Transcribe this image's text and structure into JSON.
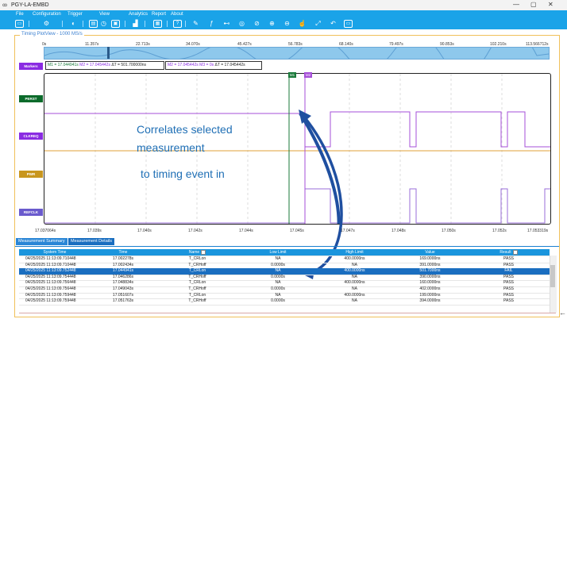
{
  "window": {
    "title": "PGY-LA-EMBD",
    "min": "—",
    "max": "▢",
    "close": "✕"
  },
  "menu": [
    "File",
    "Configuration",
    "Trigger",
    "View",
    "Analytics",
    "Report",
    "About"
  ],
  "panel": {
    "title": "Timing PlotView - 1000 MS/s"
  },
  "scale_ticks": [
    "0s",
    "11.357s",
    "22.713s",
    "34.070s",
    "45.427s",
    "56.783s",
    "68.140s",
    "79.497s",
    "90.853s",
    "102.210s",
    "113.566712s"
  ],
  "channels": [
    {
      "label": "Markers",
      "color": "#8a2be2"
    },
    {
      "label": "PERST",
      "color": "#0a6a2a"
    },
    {
      "label": "CLKREQ",
      "color": "#8a2be2"
    },
    {
      "label": "PWR",
      "color": "#c8961e"
    },
    {
      "label": "REFCLK",
      "color": "#6a5acd"
    }
  ],
  "markers": {
    "box1_a": "M1 = 17.044941s",
    "box1_b": "M2 = 17.045442s",
    "box1_c": "ΔT = 501.700000ns",
    "box2_a": "M2 = 17.045442s",
    "box2_b": "M3 = 0s",
    "box2_c": "ΔT = 17.045442s",
    "m1": "M1",
    "m2": "M2"
  },
  "x_ticks": [
    "17.037064s",
    "17.039s",
    "17.040s",
    "17.042s",
    "17.044s",
    "17.045s",
    "17.047s",
    "17.048s",
    "17.050s",
    "17.052s",
    "17.053319s"
  ],
  "annotation": {
    "line1": "Correlates selected",
    "line2": "measurement",
    "line3": "to timing event in"
  },
  "tabs": [
    "Measurement Summary",
    "Measurement Details"
  ],
  "table": {
    "columns": [
      "System Time",
      "Time",
      "Name",
      "Low Limit",
      "High Limit",
      "Value",
      "Result"
    ],
    "rows": [
      [
        "04/25/2025 11:13:09.710448",
        "17.002278s",
        "T_CRLon",
        "NA",
        "400.0000ns",
        "169.0000ns",
        "PASS"
      ],
      [
        "04/25/2025 11:13:09.710448",
        "17.002434s",
        "T_CRHoff",
        "0.0000s",
        "NA",
        "391.0000ns",
        "PASS"
      ],
      [
        "04/25/2025 11:13:09.752448",
        "17.044941s",
        "T_CRLon",
        "NA",
        "400.0000ns",
        "501.7000ns",
        "FAIL"
      ],
      [
        "04/25/2025 11:13:09.754448",
        "17.046286s",
        "T_CRHoff",
        "0.0000s",
        "NA",
        "390.0000ns",
        "PASS"
      ],
      [
        "04/25/2025 11:13:09.756448",
        "17.048834s",
        "T_CRLon",
        "NA",
        "400.0000ns",
        "160.0000ns",
        "PASS"
      ],
      [
        "04/25/2025 11:13:09.756448",
        "17.049043s",
        "T_CRHoff",
        "0.0000s",
        "NA",
        "402.0000ns",
        "PASS"
      ],
      [
        "04/25/2025 11:13:09.759448",
        "17.051607s",
        "T_CRLon",
        "NA",
        "400.0000ns",
        "199.0000ns",
        "PASS"
      ],
      [
        "04/25/2025 11:13:09.759448",
        "17.051763s",
        "T_CRHoff",
        "0.0000s",
        "NA",
        "394.0000ns",
        "PASS"
      ]
    ],
    "selected_row": 2
  },
  "back_arrow": "←"
}
